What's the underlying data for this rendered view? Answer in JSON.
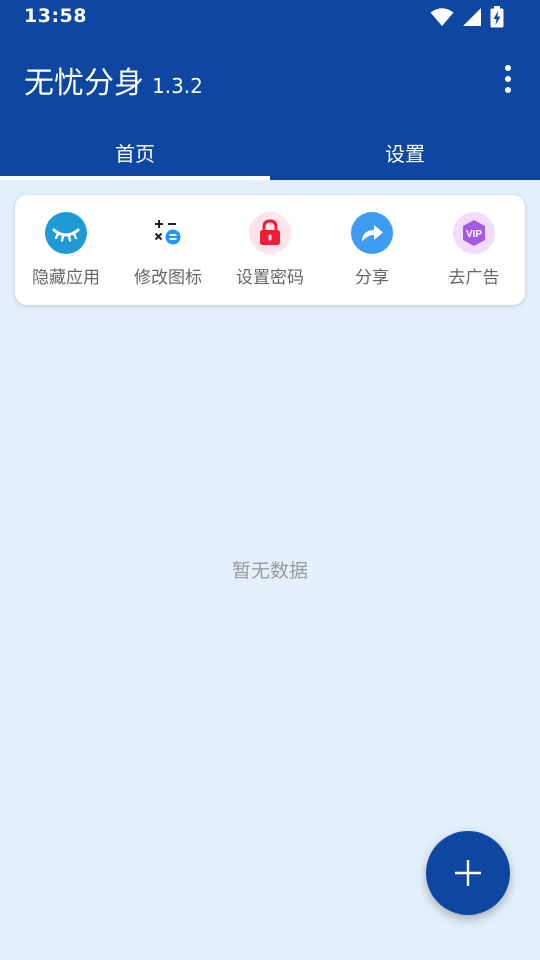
{
  "status_bar": {
    "time": "13:58",
    "icons": [
      "wifi-icon",
      "cell-signal-icon",
      "battery-charging-icon"
    ]
  },
  "app_bar": {
    "name": "无忧分身",
    "version": "1.3.2",
    "background_color": "#0d47a1"
  },
  "tabs": [
    {
      "label": "首页",
      "selected": true
    },
    {
      "label": "设置",
      "selected": false
    }
  ],
  "shortcuts": [
    {
      "label": "隐藏应用",
      "icon": "closed-eye-icon",
      "color": "#1e9ad6"
    },
    {
      "label": "修改图标",
      "icon": "calculator-icon",
      "color": "#2196f3"
    },
    {
      "label": "设置密码",
      "icon": "lock-icon",
      "color": "#ef1c3a"
    },
    {
      "label": "分享",
      "icon": "share-arrow-icon",
      "color": "#3d9bf1"
    },
    {
      "label": "去广告",
      "icon": "vip-icon",
      "color": "#a45ae6"
    }
  ],
  "main": {
    "empty_text": "暂无数据"
  },
  "fab": {
    "icon": "plus-icon"
  }
}
